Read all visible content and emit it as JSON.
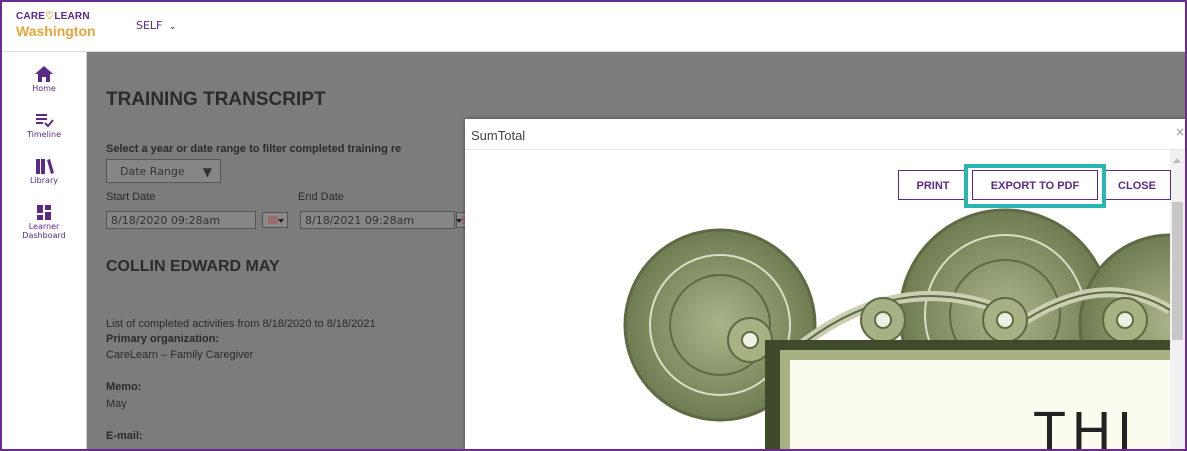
{
  "header": {
    "logo_line1": "CARE",
    "logo_line1b": "LEARN",
    "logo_line2": "Washington",
    "menu_label": "SELF"
  },
  "sidebar": {
    "items": [
      {
        "label": "Home",
        "icon": "home-icon"
      },
      {
        "label": "Timeline",
        "icon": "timeline-icon"
      },
      {
        "label": "Library",
        "icon": "library-icon"
      },
      {
        "label": "Learner",
        "label2": "Dashboard",
        "icon": "dashboard-icon"
      }
    ]
  },
  "page": {
    "title": "TRAINING TRANSCRIPT",
    "filter_prompt": "Select a year or date range to filter completed training re",
    "range_select": "Date Range",
    "start_label": "Start Date",
    "end_label": "End Date",
    "start_value": "8/18/2020 09:28am",
    "end_value": "8/18/2021 09:28am",
    "learner_name": "COLLIN EDWARD MAY",
    "activities_text": "List of completed activities from  8/18/2020  to  8/18/2021",
    "primary_org_label": "Primary organization:",
    "primary_org_value": "CareLearn – Family Caregiver",
    "memo_label": "Memo:",
    "memo_value": "May",
    "email_label": "E-mail:"
  },
  "modal": {
    "title": "SumTotal",
    "close_x": "×",
    "print_label": "PRINT",
    "export_label": "EXPORT TO PDF",
    "close_label": "CLOSE",
    "cert_text": "THI"
  },
  "colors": {
    "brand_purple": "#5b2a86",
    "brand_gold": "#e8a33a",
    "highlight_teal": "#29b5b0",
    "certificate_green": "#7d8a5e"
  }
}
